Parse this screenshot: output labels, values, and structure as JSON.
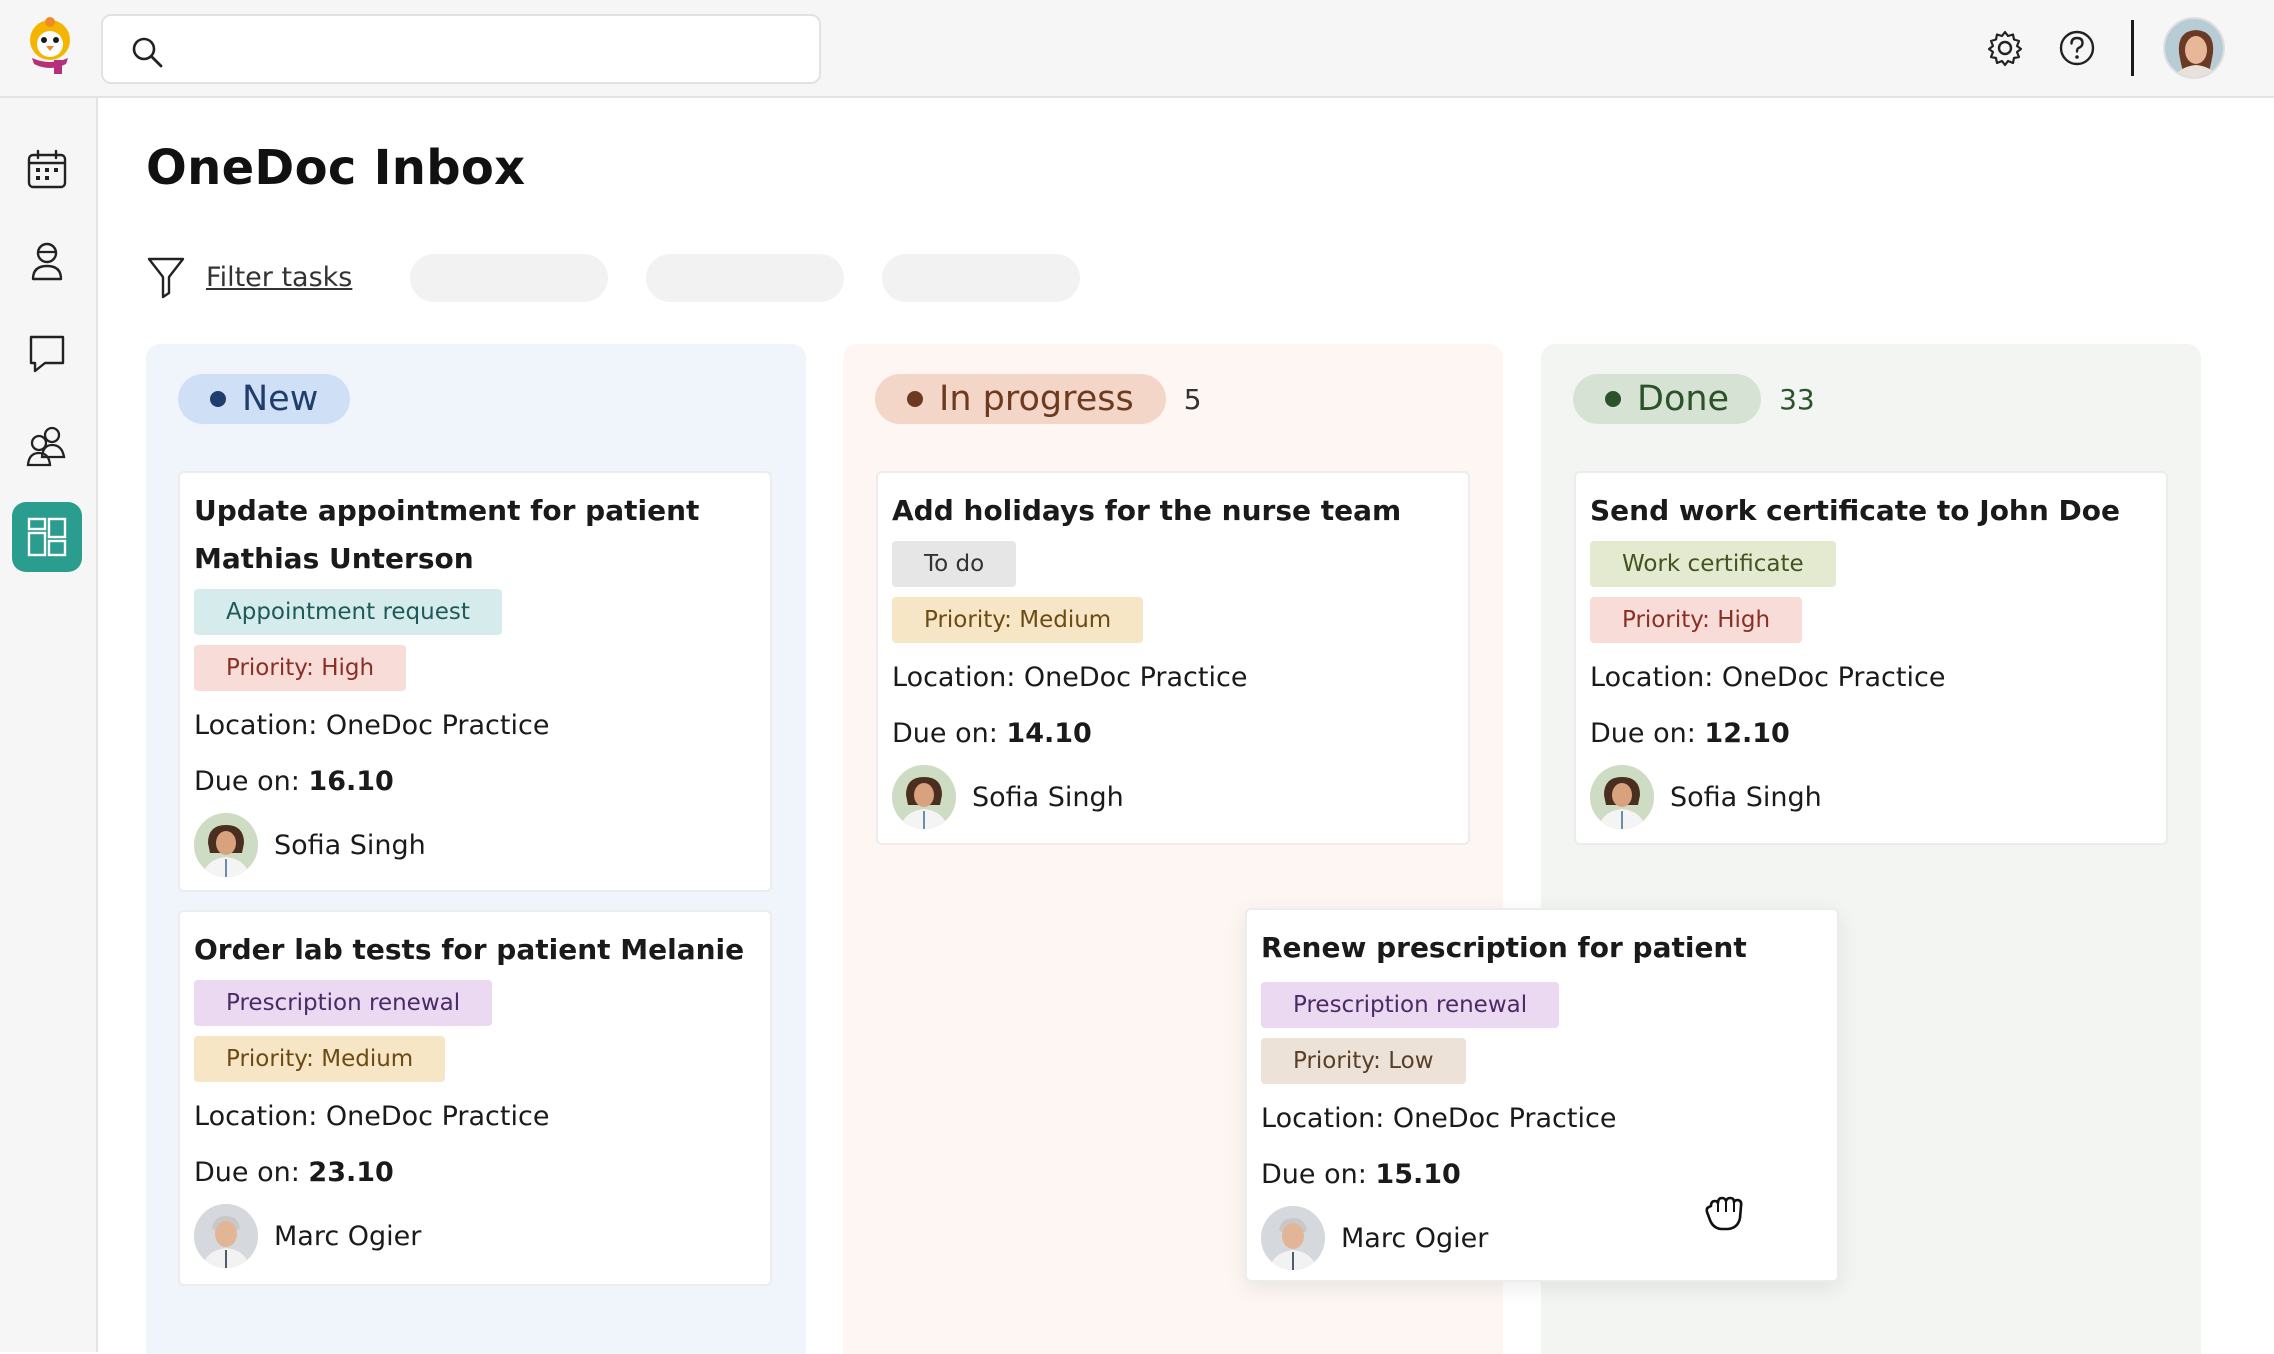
{
  "app": {
    "title": "OneDoc Inbox",
    "search_placeholder": "",
    "icons": {
      "logo": "penguin-logo",
      "search": "search-icon",
      "settings": "gear-icon",
      "help": "help-icon"
    },
    "accent_color": "#2a9d8f"
  },
  "sidebar": {
    "items": [
      {
        "name": "calendar",
        "icon": "calendar-icon",
        "active": false
      },
      {
        "name": "patients",
        "icon": "patient-icon",
        "active": false
      },
      {
        "name": "messages",
        "icon": "chat-icon",
        "active": false
      },
      {
        "name": "team",
        "icon": "team-icon",
        "active": false
      },
      {
        "name": "inbox",
        "icon": "dashboard-icon",
        "active": true
      }
    ]
  },
  "filter": {
    "label": "Filter tasks"
  },
  "columns": [
    {
      "id": "new",
      "label": "New",
      "count": ""
    },
    {
      "id": "in-progress",
      "label": "In progress",
      "count": "5"
    },
    {
      "id": "done",
      "label": "Done",
      "count": "33"
    }
  ],
  "common": {
    "location_prefix": "Location: ",
    "due_prefix": "Due on: "
  },
  "cards": {
    "new_1": {
      "title_line1": "Update appointment for patient",
      "title_line2": "Mathias Unterson",
      "tags": [
        "Appointment request",
        "Priority: High"
      ],
      "location": "OneDoc Practice",
      "due": "16.10",
      "assignee": "Sofia Singh"
    },
    "new_2": {
      "title_line1": "Order lab tests for patient Melanie Müller",
      "tags": [
        "Prescription renewal",
        "Priority: Medium"
      ],
      "location": "OneDoc Practice",
      "due": "23.10",
      "assignee": "Marc Ogier"
    },
    "prog_1": {
      "title_line1": "Add holidays for the nurse team",
      "tags": [
        "To do",
        "Priority: Medium"
      ],
      "location": "OneDoc Practice",
      "due": "14.10",
      "assignee": "Sofia Singh"
    },
    "done_1": {
      "title_line1": "Send work certificate to John Doe",
      "tags": [
        "Work certificate",
        "Priority: High"
      ],
      "location": "OneDoc Practice",
      "due": "12.10",
      "assignee": "Sofia Singh"
    },
    "drag_1": {
      "title_line1": "Renew prescription for patient Claire Noyer",
      "tags": [
        "Prescription renewal",
        "Priority: Low"
      ],
      "location": "OneDoc Practice",
      "due": "15.10",
      "assignee": "Marc Ogier"
    }
  }
}
